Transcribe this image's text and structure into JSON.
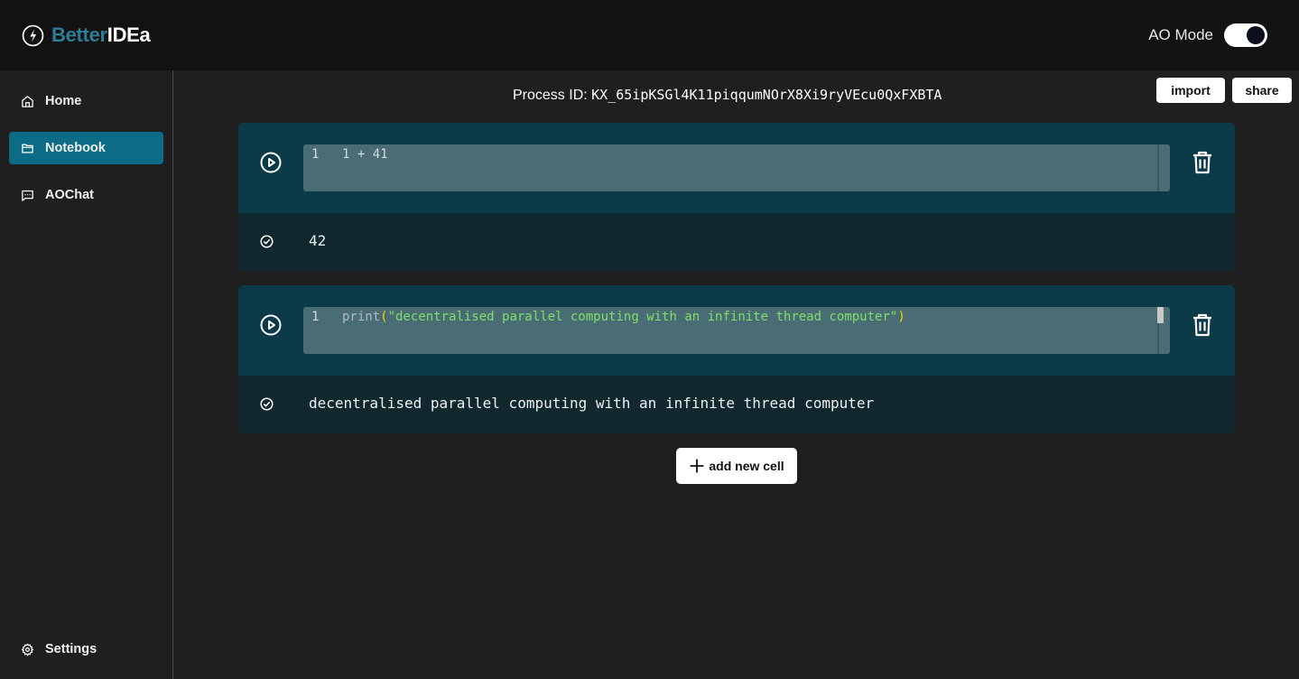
{
  "app": {
    "brand_part1": "Better",
    "brand_part2": "IDEa",
    "mode_label": "AO Mode",
    "mode_enabled": true,
    "accent_color": "#0c6c86"
  },
  "sidebar": {
    "items": [
      {
        "label": "Home",
        "icon": "home-icon",
        "active": false
      },
      {
        "label": "Notebook",
        "icon": "folder-icon",
        "active": true
      },
      {
        "label": "AOChat",
        "icon": "chat-icon",
        "active": false
      }
    ],
    "settings_label": "Settings"
  },
  "notebook": {
    "process_label": "Process ID:",
    "process_id": "KX_65ipKSGl4K11piqqumNOrX8Xi9ryVEcu0QxFXBTA",
    "import_label": "import",
    "share_label": "share",
    "add_cell_label": "add new cell",
    "cells": [
      {
        "line_number": "1",
        "code": "1 + 41",
        "output": "42"
      },
      {
        "line_number": "1",
        "code_fn": "print",
        "code_open": "(",
        "code_str": "\"decentralised parallel computing with an infinite thread computer\"",
        "code_close": ")",
        "output": "decentralised parallel computing with an infinite thread computer"
      }
    ]
  }
}
